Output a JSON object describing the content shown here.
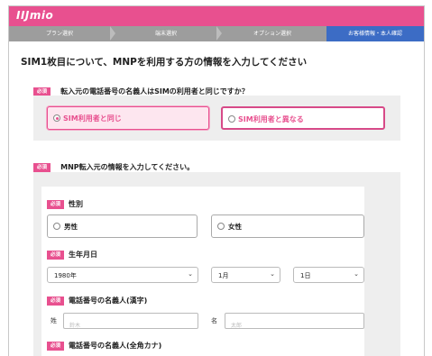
{
  "header": {
    "logo": "IIJmio"
  },
  "steps": [
    "プラン選択",
    "端末選択",
    "オプション選択",
    "お客様情報・本人確認"
  ],
  "page_title": "SIM1枚目について、MNPを利用する方の情報を入力してください",
  "badge": "必須",
  "q1": {
    "text": "転入元の電話番号の名義人はSIMの利用者と同じですか？",
    "options": [
      "SIM利用者と同じ",
      "SIM利用者と異なる"
    ]
  },
  "q2": {
    "text": "MNP転入元の情報を入力してください。"
  },
  "form": {
    "gender_label": "性別",
    "gender_options": [
      "男性",
      "女性"
    ],
    "birth_label": "生年月日",
    "year": "1980年",
    "month": "1月",
    "day": "1日",
    "name_kanji_label": "電話番号の名義人(漢字)",
    "last_name_label": "姓",
    "first_name_label": "名",
    "last_name_placeholder": "鈴木",
    "first_name_placeholder": "太郎",
    "name_kana_label": "電話番号の名義人(全角カナ)"
  },
  "colors": {
    "brand": "#e8508f",
    "active_step": "#3c6cc5",
    "step_bg": "#9d9d9d"
  }
}
